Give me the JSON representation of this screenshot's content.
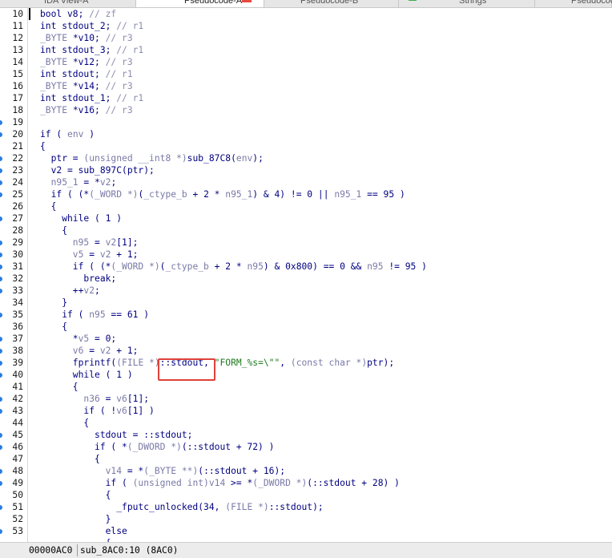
{
  "tabs": [
    {
      "label": "IDA View-A",
      "active": false
    },
    {
      "label": "Pseudocode-A",
      "active": true
    },
    {
      "label": "Pseudocode-B",
      "active": false
    },
    {
      "label": "Strings",
      "active": false
    },
    {
      "label": "Pseudocode",
      "active": false
    }
  ],
  "code_lines": [
    {
      "n": "10",
      "bp": false,
      "seg": [
        [
          "k",
          "bool v8; "
        ],
        [
          "c",
          "// zf"
        ]
      ]
    },
    {
      "n": "11",
      "bp": false,
      "seg": [
        [
          "k",
          "int stdout_2; "
        ],
        [
          "c",
          "// r1"
        ]
      ]
    },
    {
      "n": "12",
      "bp": false,
      "seg": [
        [
          "v",
          "_BYTE "
        ],
        [
          "k",
          "*v10; "
        ],
        [
          "c",
          "// r3"
        ]
      ]
    },
    {
      "n": "13",
      "bp": false,
      "seg": [
        [
          "k",
          "int stdout_3; "
        ],
        [
          "c",
          "// r1"
        ]
      ]
    },
    {
      "n": "14",
      "bp": false,
      "seg": [
        [
          "v",
          "_BYTE "
        ],
        [
          "k",
          "*v12; "
        ],
        [
          "c",
          "// r3"
        ]
      ]
    },
    {
      "n": "15",
      "bp": false,
      "seg": [
        [
          "k",
          "int stdout; "
        ],
        [
          "c",
          "// r1"
        ]
      ]
    },
    {
      "n": "16",
      "bp": false,
      "seg": [
        [
          "v",
          "_BYTE "
        ],
        [
          "k",
          "*v14; "
        ],
        [
          "c",
          "// r3"
        ]
      ]
    },
    {
      "n": "17",
      "bp": false,
      "seg": [
        [
          "k",
          "int stdout_1; "
        ],
        [
          "c",
          "// r1"
        ]
      ]
    },
    {
      "n": "18",
      "bp": false,
      "seg": [
        [
          "v",
          "_BYTE "
        ],
        [
          "k",
          "*v16; "
        ],
        [
          "c",
          "// r3"
        ]
      ]
    },
    {
      "n": "19",
      "bp": true,
      "seg": []
    },
    {
      "n": "20",
      "bp": true,
      "seg": [
        [
          "k",
          "if ( "
        ],
        [
          "v",
          "env"
        ],
        [
          "k",
          " )"
        ]
      ]
    },
    {
      "n": "21",
      "bp": false,
      "seg": [
        [
          "k",
          "{"
        ]
      ]
    },
    {
      "n": "22",
      "bp": true,
      "seg": [
        [
          "k",
          "  ptr = "
        ],
        [
          "v",
          "(unsigned __int8 *)"
        ],
        [
          "f",
          "sub_87C8"
        ],
        [
          "k",
          "("
        ],
        [
          "v",
          "env"
        ],
        [
          "k",
          ");"
        ]
      ]
    },
    {
      "n": "23",
      "bp": true,
      "seg": [
        [
          "k",
          "  v2 = "
        ],
        [
          "f",
          "sub_897C"
        ],
        [
          "k",
          "(ptr);"
        ]
      ]
    },
    {
      "n": "24",
      "bp": true,
      "seg": [
        [
          "v",
          "  n95_1"
        ],
        [
          "k",
          " = *"
        ],
        [
          "v",
          "v2"
        ],
        [
          "k",
          ";"
        ]
      ]
    },
    {
      "n": "25",
      "bp": true,
      "seg": [
        [
          "k",
          "  if ( (*"
        ],
        [
          "v",
          "(_WORD *)"
        ],
        [
          "k",
          "("
        ],
        [
          "v",
          "_ctype_b"
        ],
        [
          "k",
          " + 2 * "
        ],
        [
          "v",
          "n95_1"
        ],
        [
          "k",
          ") & 4) != 0 || "
        ],
        [
          "v",
          "n95_1"
        ],
        [
          "k",
          " == 95 )"
        ]
      ]
    },
    {
      "n": "26",
      "bp": false,
      "seg": [
        [
          "k",
          "  {"
        ]
      ]
    },
    {
      "n": "27",
      "bp": true,
      "seg": [
        [
          "k",
          "    while ( 1 )"
        ]
      ]
    },
    {
      "n": "28",
      "bp": false,
      "seg": [
        [
          "k",
          "    {"
        ]
      ]
    },
    {
      "n": "29",
      "bp": true,
      "seg": [
        [
          "v",
          "      n95"
        ],
        [
          "k",
          " = "
        ],
        [
          "v",
          "v2"
        ],
        [
          "k",
          "[1];"
        ]
      ]
    },
    {
      "n": "30",
      "bp": true,
      "seg": [
        [
          "v",
          "      v5"
        ],
        [
          "k",
          " = "
        ],
        [
          "v",
          "v2"
        ],
        [
          "k",
          " + 1;"
        ]
      ]
    },
    {
      "n": "31",
      "bp": true,
      "seg": [
        [
          "k",
          "      if ( (*"
        ],
        [
          "v",
          "(_WORD *)"
        ],
        [
          "k",
          "("
        ],
        [
          "v",
          "_ctype_b"
        ],
        [
          "k",
          " + 2 * "
        ],
        [
          "v",
          "n95"
        ],
        [
          "k",
          ") & 0x800) == 0 && "
        ],
        [
          "v",
          "n95"
        ],
        [
          "k",
          " != 95 )"
        ]
      ]
    },
    {
      "n": "32",
      "bp": true,
      "seg": [
        [
          "k",
          "        break;"
        ]
      ]
    },
    {
      "n": "33",
      "bp": true,
      "seg": [
        [
          "k",
          "      ++"
        ],
        [
          "v",
          "v2"
        ],
        [
          "k",
          ";"
        ]
      ]
    },
    {
      "n": "34",
      "bp": false,
      "seg": [
        [
          "k",
          "    }"
        ]
      ]
    },
    {
      "n": "35",
      "bp": true,
      "seg": [
        [
          "k",
          "    if ( "
        ],
        [
          "v",
          "n95"
        ],
        [
          "k",
          " == 61 )"
        ]
      ]
    },
    {
      "n": "36",
      "bp": false,
      "seg": [
        [
          "k",
          "    {"
        ]
      ]
    },
    {
      "n": "37",
      "bp": true,
      "seg": [
        [
          "k",
          "      *"
        ],
        [
          "v",
          "v5"
        ],
        [
          "k",
          " = 0;"
        ]
      ]
    },
    {
      "n": "38",
      "bp": true,
      "seg": [
        [
          "v",
          "      v6"
        ],
        [
          "k",
          " = "
        ],
        [
          "v",
          "v2"
        ],
        [
          "k",
          " + 1;"
        ]
      ]
    },
    {
      "n": "39",
      "bp": true,
      "seg": [
        [
          "f",
          "      fprintf"
        ],
        [
          "k",
          "("
        ],
        [
          "v",
          "(FILE *)"
        ],
        [
          "k",
          "::stdout, "
        ],
        [
          "s",
          "\"FORM_%s=\\\"\""
        ],
        [
          "k",
          ", "
        ],
        [
          "v",
          "(const char *)"
        ],
        [
          "k",
          "ptr);"
        ]
      ]
    },
    {
      "n": "40",
      "bp": true,
      "seg": [
        [
          "k",
          "      while ( 1 )"
        ]
      ]
    },
    {
      "n": "41",
      "bp": false,
      "seg": [
        [
          "k",
          "      {"
        ]
      ]
    },
    {
      "n": "42",
      "bp": true,
      "seg": [
        [
          "v",
          "        n36"
        ],
        [
          "k",
          " = "
        ],
        [
          "v",
          "v6"
        ],
        [
          "k",
          "[1];"
        ]
      ]
    },
    {
      "n": "43",
      "bp": true,
      "seg": [
        [
          "k",
          "        if ( !"
        ],
        [
          "v",
          "v6"
        ],
        [
          "k",
          "[1] )"
        ]
      ]
    },
    {
      "n": "44",
      "bp": false,
      "seg": [
        [
          "k",
          "        {"
        ]
      ]
    },
    {
      "n": "45",
      "bp": true,
      "seg": [
        [
          "k",
          "          stdout = ::stdout;"
        ]
      ]
    },
    {
      "n": "46",
      "bp": true,
      "seg": [
        [
          "k",
          "          if ( *"
        ],
        [
          "v",
          "(_DWORD *)"
        ],
        [
          "k",
          "(::stdout + 72) )"
        ]
      ]
    },
    {
      "n": "47",
      "bp": false,
      "seg": [
        [
          "k",
          "          {"
        ]
      ]
    },
    {
      "n": "48",
      "bp": true,
      "seg": [
        [
          "v",
          "            v14"
        ],
        [
          "k",
          " = *"
        ],
        [
          "v",
          "(_BYTE **)"
        ],
        [
          "k",
          "(::stdout + 16);"
        ]
      ]
    },
    {
      "n": "49",
      "bp": true,
      "seg": [
        [
          "k",
          "            if ( "
        ],
        [
          "v",
          "(unsigned int)"
        ],
        [
          "v",
          "v14"
        ],
        [
          "k",
          " >= *"
        ],
        [
          "v",
          "(_DWORD *)"
        ],
        [
          "k",
          "(::stdout + 28) )"
        ]
      ]
    },
    {
      "n": "50",
      "bp": false,
      "seg": [
        [
          "k",
          "            {"
        ]
      ]
    },
    {
      "n": "51",
      "bp": true,
      "seg": [
        [
          "f",
          "              _fputc_unlocked"
        ],
        [
          "k",
          "(34, "
        ],
        [
          "v",
          "(FILE *)"
        ],
        [
          "k",
          "::stdout);"
        ]
      ]
    },
    {
      "n": "52",
      "bp": false,
      "seg": [
        [
          "k",
          "            }"
        ]
      ]
    },
    {
      "n": "53",
      "bp": true,
      "seg": [
        [
          "k",
          "            else"
        ]
      ]
    },
    {
      "n": "",
      "bp": false,
      "seg": [
        [
          "k",
          "            {"
        ]
      ]
    }
  ],
  "status": {
    "address": "00000AC0",
    "location": "sub_8AC0:10 (8AC0)"
  }
}
